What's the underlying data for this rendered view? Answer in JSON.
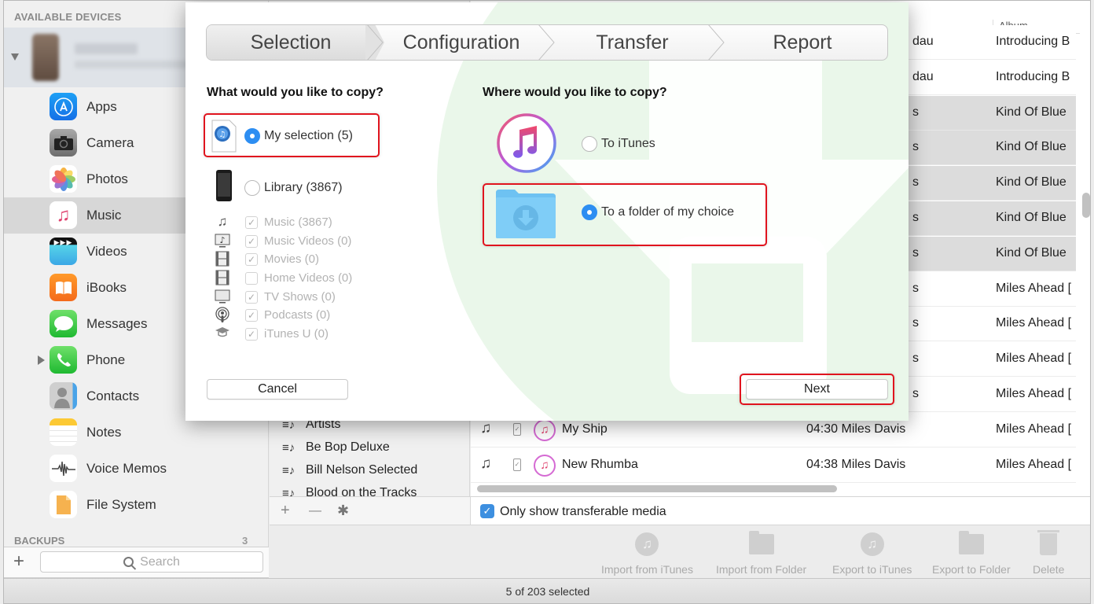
{
  "sidebar": {
    "header": "AVAILABLE DEVICES",
    "items": [
      {
        "label": "Apps",
        "icon": "app-store-icon"
      },
      {
        "label": "Camera",
        "icon": "camera-icon"
      },
      {
        "label": "Photos",
        "icon": "photos-icon"
      },
      {
        "label": "Music",
        "icon": "music-icon"
      },
      {
        "label": "Videos",
        "icon": "videos-icon"
      },
      {
        "label": "iBooks",
        "icon": "ibooks-icon"
      },
      {
        "label": "Messages",
        "icon": "messages-icon"
      },
      {
        "label": "Phone",
        "icon": "phone-icon"
      },
      {
        "label": "Contacts",
        "icon": "contacts-icon"
      },
      {
        "label": "Notes",
        "icon": "notes-icon"
      },
      {
        "label": "Voice Memos",
        "icon": "voice-memos-icon"
      },
      {
        "label": "File System",
        "icon": "file-system-icon"
      }
    ],
    "selected": "Music",
    "backups_label": "BACKUPS",
    "backups_count": "3",
    "search_placeholder": "Search",
    "add_symbol": "+"
  },
  "playlists": {
    "items": [
      "Artists",
      "Be Bop Deluxe",
      "Bill Nelson Selected",
      "Blood on the Tracks"
    ],
    "footer": {
      "add": "+",
      "remove": "—",
      "settings": "✱"
    }
  },
  "table": {
    "album_header": "Album",
    "rows": [
      {
        "artist_tail": "dau",
        "album": "Introducing B",
        "selected": false
      },
      {
        "artist_tail": "dau",
        "album": "Introducing B",
        "selected": false
      },
      {
        "artist_tail": "s",
        "album": "Kind Of Blue",
        "selected": true
      },
      {
        "artist_tail": "s",
        "album": "Kind Of Blue",
        "selected": true
      },
      {
        "artist_tail": "s",
        "album": "Kind Of Blue",
        "selected": true
      },
      {
        "artist_tail": "s",
        "album": "Kind Of Blue",
        "selected": true
      },
      {
        "artist_tail": "s",
        "album": "Kind Of Blue",
        "selected": true
      },
      {
        "artist_tail": "s",
        "album": "Miles Ahead [",
        "selected": false
      },
      {
        "artist_tail": "s",
        "album": "Miles Ahead [",
        "selected": false
      },
      {
        "artist_tail": "s",
        "album": "Miles Ahead [",
        "selected": false
      },
      {
        "artist_tail": "s",
        "album": "Miles Ahead [",
        "selected": false
      },
      {
        "title": "My Ship",
        "time_artist": "04:30 Miles Davis",
        "album": "Miles Ahead [",
        "selected": false
      },
      {
        "title": "New Rhumba",
        "time_artist": "04:38 Miles Davis",
        "album": "Miles Ahead [",
        "selected": false
      }
    ],
    "filter_label": "Only show transferable media",
    "filter_checked": true
  },
  "toolbar": {
    "buttons": [
      {
        "label": "Import from iTunes",
        "icon": "itunes-icon"
      },
      {
        "label": "Import from Folder",
        "icon": "folder-icon"
      },
      {
        "label": "Export to iTunes",
        "icon": "itunes-icon"
      },
      {
        "label": "Export to Folder",
        "icon": "folder-icon"
      },
      {
        "label": "Delete",
        "icon": "trash-icon"
      }
    ]
  },
  "status": {
    "text": "5 of 203 selected"
  },
  "modal": {
    "steps": [
      "Selection",
      "Configuration",
      "Transfer",
      "Report"
    ],
    "active_step": "Selection",
    "left_title": "What would you like to copy?",
    "right_title": "Where would you like to copy?",
    "source_options": [
      {
        "label": "My selection (5)",
        "selected": true
      },
      {
        "label": "Library (3867)",
        "selected": false
      }
    ],
    "library_categories": [
      {
        "label": "Music (3867)",
        "checked": true,
        "icon": "music-note-icon"
      },
      {
        "label": "Music Videos (0)",
        "checked": true,
        "icon": "music-video-icon"
      },
      {
        "label": "Movies (0)",
        "checked": true,
        "icon": "film-icon"
      },
      {
        "label": "Home Videos (0)",
        "checked": false,
        "icon": "film-icon"
      },
      {
        "label": "TV Shows (0)",
        "checked": true,
        "icon": "tv-icon"
      },
      {
        "label": "Podcasts (0)",
        "checked": true,
        "icon": "podcast-icon"
      },
      {
        "label": "iTunes U (0)",
        "checked": true,
        "icon": "graduation-cap-icon"
      }
    ],
    "destination_options": [
      {
        "label": "To iTunes",
        "selected": false
      },
      {
        "label": "To a folder of my choice",
        "selected": true
      }
    ],
    "cancel_label": "Cancel",
    "next_label": "Next"
  },
  "colors": {
    "accent": "#2d8ef2",
    "highlight_box": "#e0141e",
    "selected_row": "#dcdcdc",
    "watermark_green": "#e8f7e8"
  }
}
